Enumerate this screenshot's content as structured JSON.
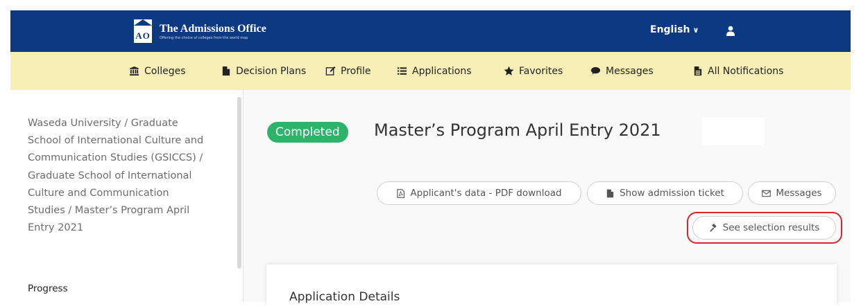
{
  "header": {
    "brand_title": "The Admissions Office",
    "brand_subtitle": "Offering the choice of colleges from the world map",
    "logo_letters": "AO",
    "language": "English",
    "colors": {
      "header_bg": "#0b3a82",
      "nav_bg": "#f7efb6"
    }
  },
  "nav": {
    "items": [
      {
        "label": "Colleges",
        "icon": "university-icon"
      },
      {
        "label": "Decision Plans",
        "icon": "file-icon"
      },
      {
        "label": "Profile",
        "icon": "edit-icon"
      },
      {
        "label": "Applications",
        "icon": "list-icon"
      },
      {
        "label": "Favorites",
        "icon": "star-icon"
      },
      {
        "label": "Messages",
        "icon": "comment-icon"
      },
      {
        "label": "All Notifications",
        "icon": "file-text-icon"
      }
    ]
  },
  "sidebar": {
    "breadcrumb": "Waseda University / Graduate School of International Culture and Communication Studies (GSICCS) / Graduate School of International Culture and Communication Studies / Master’s Program April Entry 2021",
    "progress_label": "Progress"
  },
  "main": {
    "status_badge": "Completed",
    "status_color": "#2db36a",
    "title": "Master’s Program April Entry  2021",
    "buttons": {
      "pdf_download": "Applicant's data - PDF download",
      "admission_ticket": "Show admission ticket",
      "messages": "Messages",
      "selection_results": "See selection results"
    },
    "card_title": "Application Details"
  }
}
